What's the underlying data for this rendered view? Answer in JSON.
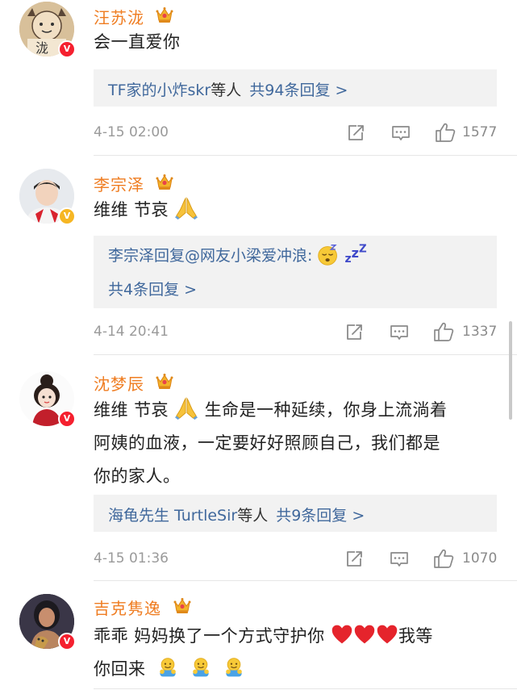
{
  "comments": [
    {
      "name": "汪苏泷",
      "badge": "V",
      "text": "会一直爱你",
      "reply_summary": {
        "users": "TF家的小炸skr",
        "suffix": "等人",
        "total": "共94条回复 >"
      },
      "time": "4-15 02:00",
      "likes": "1577",
      "avatar_caption": "泷"
    },
    {
      "name": "李宗泽",
      "badge": "V",
      "text": "维维 节哀",
      "reply_preview": "李宗泽回复@网友小梁爱冲浪:",
      "reply_total": "共4条回复 >",
      "time": "4-14 20:41",
      "likes": "1337"
    },
    {
      "name": "沈梦辰",
      "badge": "V",
      "text_lines": [
        "维维 节哀",
        "生命是一种延续，你身上流淌着",
        "阿姨的血液，一定要好好照顾自己，我们都是",
        "你的家人。"
      ],
      "reply_summary": {
        "users": "海龟先生 TurtleSir",
        "suffix": "等人",
        "total": "共9条回复 >"
      },
      "time": "4-15 01:36",
      "likes": "1070"
    },
    {
      "name": "吉克隽逸",
      "badge": "V",
      "text_lines": [
        "乖乖 妈妈换了一个方式守护你",
        "我等",
        "你回来"
      ]
    }
  ],
  "icons": [
    "crown-badge-icon",
    "share-icon",
    "comment-icon",
    "like-icon",
    "prayer-emoji",
    "sleeping-emoji",
    "heart-emoji",
    "hug-emoji"
  ],
  "colors": {
    "name": "#ef7d22",
    "link": "#40689c",
    "meta": "#9a9a9a",
    "verified_red": "#f5202f",
    "verified_gold": "#f6b623"
  }
}
